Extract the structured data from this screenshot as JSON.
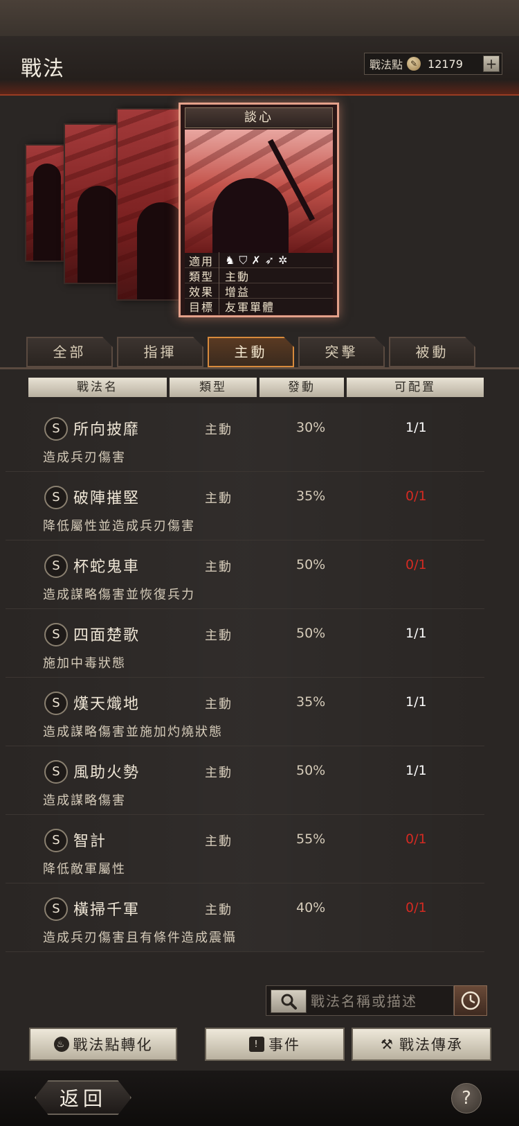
{
  "header": {
    "title": "戰法",
    "points_label": "戰法點",
    "points_value": "12179",
    "plus_label": "+"
  },
  "card": {
    "name": "談心",
    "rows": [
      {
        "key": "適用",
        "value": ""
      },
      {
        "key": "類型",
        "value": "主動"
      },
      {
        "key": "效果",
        "value": "增益"
      },
      {
        "key": "目標",
        "value": "友軍單體"
      }
    ],
    "troop_icons": [
      "cavalry-icon",
      "shield-icon",
      "bow-icon",
      "spear-icon",
      "wheel-icon"
    ]
  },
  "tabs": [
    {
      "label": "全部",
      "active": false
    },
    {
      "label": "指揮",
      "active": false
    },
    {
      "label": "主動",
      "active": true
    },
    {
      "label": "突擊",
      "active": false
    },
    {
      "label": "被動",
      "active": false
    }
  ],
  "columns": [
    "戰法名",
    "類型",
    "發動",
    "可配置"
  ],
  "tactics": [
    {
      "grade": "S",
      "name": "所向披靡",
      "type": "主動",
      "rate": "30%",
      "slots": "1/1",
      "available": true,
      "desc": "造成兵刃傷害"
    },
    {
      "grade": "S",
      "name": "破陣摧堅",
      "type": "主動",
      "rate": "35%",
      "slots": "0/1",
      "available": false,
      "desc": "降低屬性並造成兵刃傷害"
    },
    {
      "grade": "S",
      "name": "杯蛇鬼車",
      "type": "主動",
      "rate": "50%",
      "slots": "0/1",
      "available": false,
      "desc": "造成謀略傷害並恢復兵力"
    },
    {
      "grade": "S",
      "name": "四面楚歌",
      "type": "主動",
      "rate": "50%",
      "slots": "1/1",
      "available": true,
      "desc": "施加中毒狀態"
    },
    {
      "grade": "S",
      "name": "熯天熾地",
      "type": "主動",
      "rate": "35%",
      "slots": "1/1",
      "available": true,
      "desc": "造成謀略傷害並施加灼燒狀態"
    },
    {
      "grade": "S",
      "name": "風助火勢",
      "type": "主動",
      "rate": "50%",
      "slots": "1/1",
      "available": true,
      "desc": "造成謀略傷害"
    },
    {
      "grade": "S",
      "name": "智計",
      "type": "主動",
      "rate": "55%",
      "slots": "0/1",
      "available": false,
      "desc": "降低敵軍屬性"
    },
    {
      "grade": "S",
      "name": "橫掃千軍",
      "type": "主動",
      "rate": "40%",
      "slots": "0/1",
      "available": false,
      "desc": "造成兵刃傷害且有條件造成震懾"
    }
  ],
  "search": {
    "placeholder": "戰法名稱或描述"
  },
  "actions": {
    "convert_label": "戰法點轉化",
    "events_label": "事件",
    "inherit_label": "戰法傳承"
  },
  "footer": {
    "back_label": "返回",
    "help_label": "?"
  },
  "colors": {
    "accent": "#d88a3c",
    "unavailable": "#d42a22",
    "header_red": "#9a3c22"
  }
}
